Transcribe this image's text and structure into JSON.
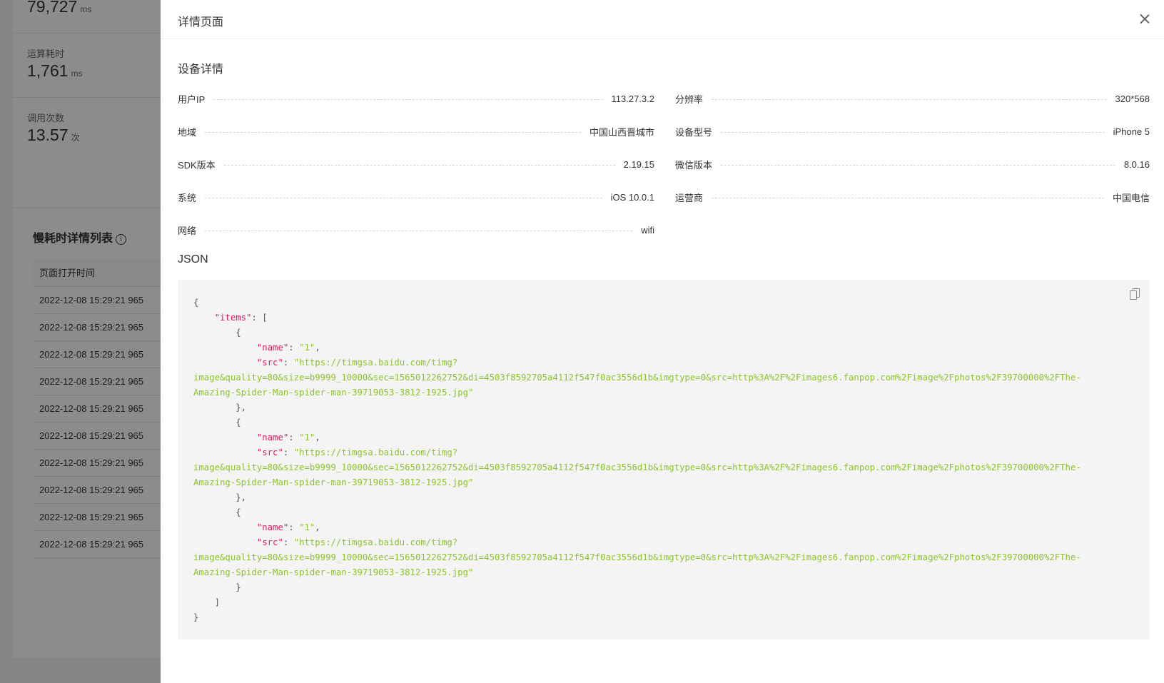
{
  "background": {
    "stats": [
      {
        "label": "",
        "value": "79,727",
        "unit": "ms"
      },
      {
        "label": "运算耗时",
        "value": "1,761",
        "unit": "ms"
      },
      {
        "label": "调用次数",
        "value": "13.57",
        "unit": "次"
      }
    ],
    "list": {
      "title": "慢耗时详情列表",
      "info_icon": "i",
      "column_header": "页面打开时间",
      "rows": [
        "2022-12-08 15:29:21 965",
        "2022-12-08 15:29:21 965",
        "2022-12-08 15:29:21 965",
        "2022-12-08 15:29:21 965",
        "2022-12-08 15:29:21 965",
        "2022-12-08 15:29:21 965",
        "2022-12-08 15:29:21 965",
        "2022-12-08 15:29:21 965",
        "2022-12-08 15:29:21 965",
        "2022-12-08 15:29:21 965"
      ]
    }
  },
  "drawer": {
    "title": "详情页面",
    "close_icon": "close-icon",
    "device_section_title": "设备详情",
    "device": {
      "user_ip": {
        "label": "用户IP",
        "value": "113.27.3.2"
      },
      "resolution": {
        "label": "分辨率",
        "value": "320*568"
      },
      "region": {
        "label": "地域",
        "value": "中国山西晋城市"
      },
      "device_model": {
        "label": "设备型号",
        "value": "iPhone 5"
      },
      "sdk_version": {
        "label": "SDK版本",
        "value": "2.19.15"
      },
      "wechat_version": {
        "label": "微信版本",
        "value": "8.0.16"
      },
      "system": {
        "label": "系统",
        "value": "iOS 10.0.1"
      },
      "carrier": {
        "label": "运营商",
        "value": "中国电信"
      },
      "network": {
        "label": "网络",
        "value": "wifi"
      }
    },
    "json_section_title": "JSON",
    "copy_icon": "copy-icon",
    "json": {
      "key_items": "\"items\"",
      "key_name": "\"name\"",
      "key_src": "\"src\"",
      "entries": [
        {
          "name": "\"1\"",
          "src_line1": "\"https://timgsa.baidu.com/timg?",
          "src_line2": "image&quality=80&size=b9999_10000&sec=1565012262752&di=4503f8592705a4112f547f0ac3556d1b&imgtype=0&src=http%3A%2F%2Fimages6.fanpop.com%2Fimage%2Fphotos%2F39700000%2FThe-",
          "src_line3": "Amazing-Spider-Man-spider-man-39719053-3812-1925.jpg\""
        },
        {
          "name": "\"1\"",
          "src_line1": "\"https://timgsa.baidu.com/timg?",
          "src_line2": "image&quality=80&size=b9999_10000&sec=1565012262752&di=4503f8592705a4112f547f0ac3556d1b&imgtype=0&src=http%3A%2F%2Fimages6.fanpop.com%2Fimage%2Fphotos%2F39700000%2FThe-",
          "src_line3": "Amazing-Spider-Man-spider-man-39719053-3812-1925.jpg\""
        },
        {
          "name": "\"1\"",
          "src_line1": "\"https://timgsa.baidu.com/timg?",
          "src_line2": "image&quality=80&size=b9999_10000&sec=1565012262752&di=4503f8592705a4112f547f0ac3556d1b&imgtype=0&src=http%3A%2F%2Fimages6.fanpop.com%2Fimage%2Fphotos%2F39700000%2FThe-",
          "src_line3": "Amazing-Spider-Man-spider-man-39719053-3812-1925.jpg\""
        }
      ]
    }
  },
  "colors": {
    "json_key": "#e2175d",
    "json_string": "#8bc42a",
    "json_background": "#f4f4f4",
    "overlay": "rgba(0,0,0,0.45)"
  }
}
